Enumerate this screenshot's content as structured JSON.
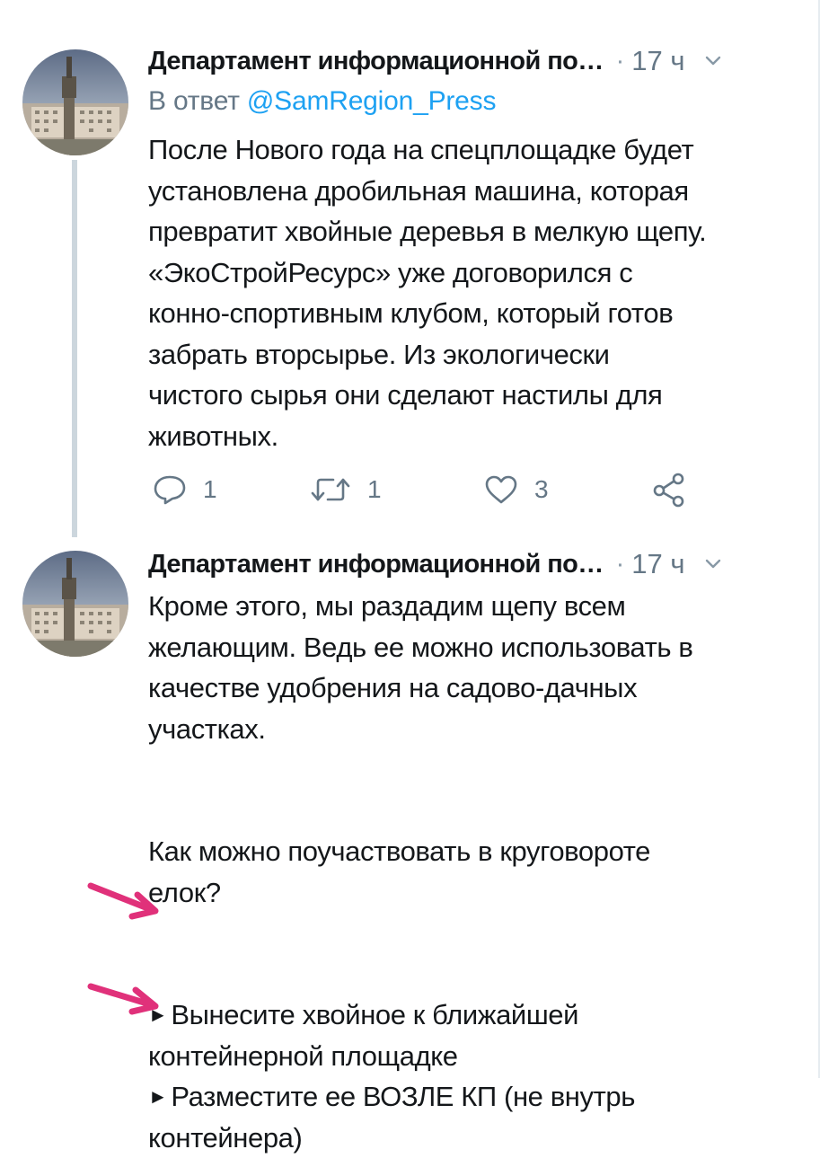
{
  "colors": {
    "text": "#14171a",
    "muted": "#657786",
    "link": "#1da1f2",
    "thread_line": "#ccd6dd",
    "annotation_arrow": "#e0317a"
  },
  "tweets": [
    {
      "author": "Департамент информационной по…",
      "separator": "·",
      "time": "17 ч",
      "reply_prefix": "В ответ",
      "reply_handle": "@SamRegion_Press",
      "lines": [
        "После Нового года на спецплощадке будет",
        "установлена дробильная машина, которая",
        "превратит хвойные деревья в мелкую щепу.",
        "«ЭкоСтройРесурс» уже договорился с",
        "конно-спортивным клубом, который готов",
        "забрать вторсырье. Из экологически",
        "чистого сырья они сделают настилы для",
        "животных."
      ],
      "actions": {
        "reply_count": "1",
        "retweet_count": "1",
        "like_count": "3"
      },
      "icons": [
        "reply-icon",
        "retweet-icon",
        "like-icon",
        "share-icon",
        "chevron-down-icon"
      ]
    },
    {
      "author": "Департамент информационной по…",
      "separator": "·",
      "time": "17 ч",
      "paragraph1": [
        "Кроме этого, мы раздадим щепу всем",
        "желающим. Ведь ее можно использовать в",
        "качестве удобрения на садово-дачных",
        "участках."
      ],
      "paragraph2": [
        "Как можно поучаствовать в круговороте",
        "елок?"
      ],
      "bullet_symbol": "►",
      "bullet1": [
        "Вынесите хвойное к ближайшей",
        "контейнерной площадке"
      ],
      "bullet2": [
        "Разместите ее ВОЗЛЕ КП (не внутрь",
        "контейнера)"
      ]
    }
  ]
}
